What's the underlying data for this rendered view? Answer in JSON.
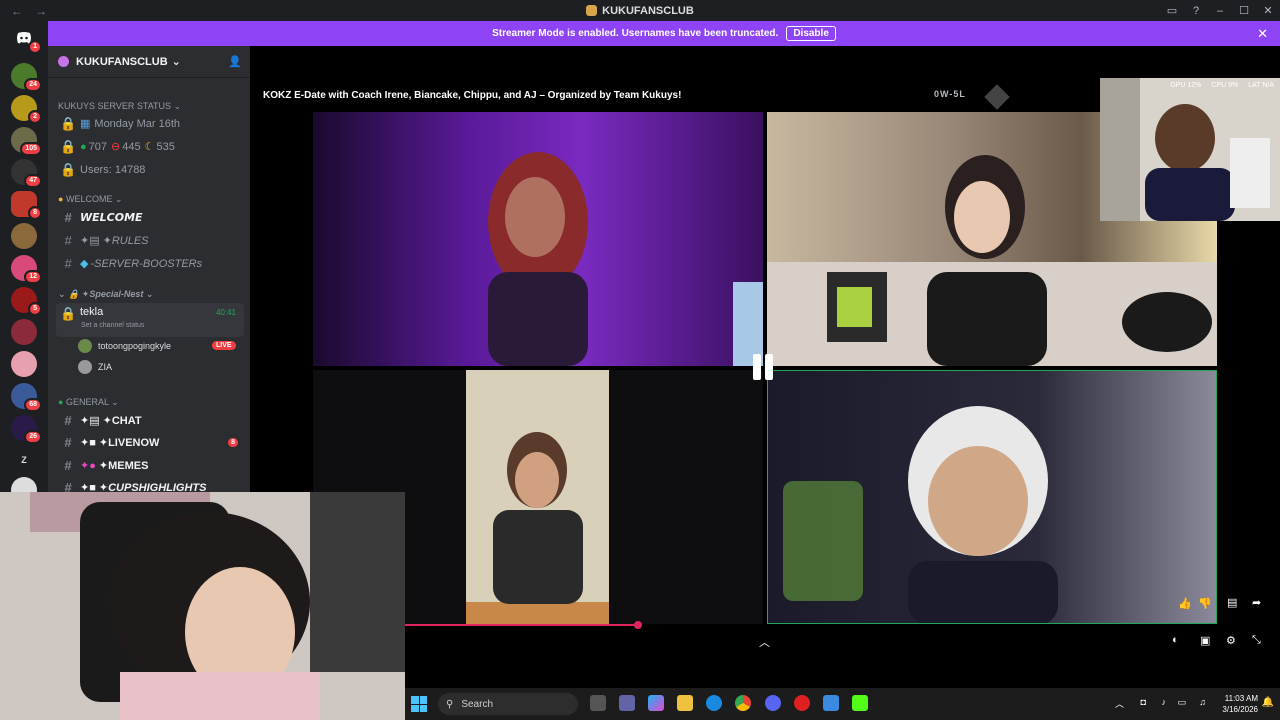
{
  "window": {
    "title": "KUKUFANSCLUB",
    "back": "←",
    "forward": "→"
  },
  "banner": {
    "text": "Streamer Mode is enabled. Usernames have been truncated.",
    "disable_label": "Disable",
    "close": "✕"
  },
  "server_badges": [
    "1",
    "24",
    "2",
    "105",
    "47",
    "8",
    "",
    "12",
    "5",
    "",
    "",
    "68",
    "26",
    "",
    ""
  ],
  "server_z": "Z",
  "guild": {
    "name": "KUKUFANSCLUB",
    "chevron": "⌄"
  },
  "server_status": {
    "header": "KUKUYS SERVER STATUS",
    "date": "Monday Mar 16th",
    "counts": "707  445  535",
    "online": "707",
    "dnd": "445",
    "idle": "535",
    "users": "Users: 14788"
  },
  "categories": {
    "welcome": "WELCOME",
    "special": "✦Special-Nest",
    "general": "GENERAL"
  },
  "channels": {
    "welcome": "𝙒𝙀𝙇𝘾𝙊𝙈𝙀",
    "rules": "✦RULES",
    "boosters": "-SERVER-BOOSTERs",
    "chat": "✦CHAT",
    "livenow": "✦LIVENOW",
    "livenow_badge": "8",
    "memes": "✦MEMES",
    "cupshighlights": "✦CUPSHIGHLIGHTS"
  },
  "voice": {
    "name": "tekla",
    "status": "Set a channel status",
    "time": "40:41",
    "users": [
      {
        "name": "totoongpogingkyle",
        "live": "LIVE"
      },
      {
        "name": "ZIA"
      }
    ]
  },
  "stream": {
    "title": "KOKZ E-Date with Coach Irene, Biancake, Chippu, and AJ – Organized by Team Kukuys!",
    "score": "0W-5L",
    "stats": {
      "gpu": "GPU 12%",
      "cpu": "CPU 9%",
      "lat": "LAT N/A"
    }
  },
  "taskbar": {
    "search_label": "Search",
    "time": "11:03 AM",
    "date": "3/16/2026"
  },
  "colors": {
    "accent": "#8e44f4",
    "live": "#f23f43",
    "progress": "#e0245e"
  }
}
